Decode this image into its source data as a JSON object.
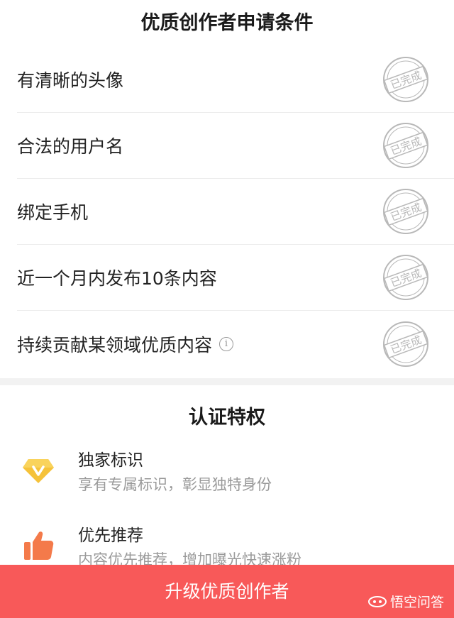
{
  "requirements": {
    "title": "优质创作者申请条件",
    "stamp_text": "已完成",
    "items": [
      {
        "label": "有清晰的头像"
      },
      {
        "label": "合法的用户名"
      },
      {
        "label": "绑定手机"
      },
      {
        "label": "近一个月内发布10条内容"
      },
      {
        "label": "持续贡献某领域优质内容"
      }
    ]
  },
  "privileges": {
    "title": "认证特权",
    "items": [
      {
        "name": "独家标识",
        "desc": "享有专属标识，彰显独特身份",
        "icon": "v-badge-icon"
      },
      {
        "name": "优先推荐",
        "desc": "内容优先推荐，增加曝光快速涨粉",
        "icon": "thumbs-up-icon"
      }
    ]
  },
  "action": {
    "label": "升级优质创作者"
  },
  "watermark": {
    "text": "悟空问答"
  },
  "colors": {
    "accent": "#f85959",
    "badge": "#f5c23a",
    "thumb": "#f47a4a",
    "stamp": "#b8b8b8"
  }
}
